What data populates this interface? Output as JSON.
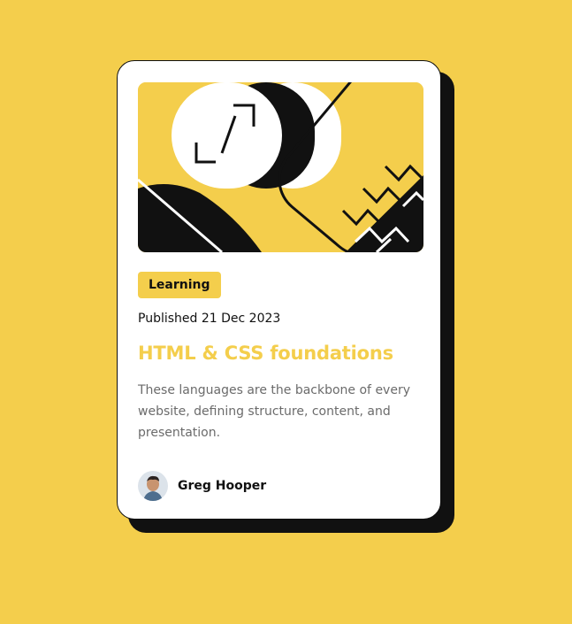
{
  "card": {
    "tag": "Learning",
    "published": "Published 21 Dec 2023",
    "title": "HTML & CSS foundations",
    "description": "These languages are the backbone of every website, defining structure, content, and presentation.",
    "author": {
      "name": "Greg Hooper"
    }
  },
  "colors": {
    "background": "#F4CE4C",
    "card": "#FFFFFF",
    "ink": "#111111",
    "accent": "#F4CE4C",
    "muted": "#6B6B6B"
  },
  "icons": {
    "hero": "abstract-illustration",
    "avatar": "author-photo"
  }
}
